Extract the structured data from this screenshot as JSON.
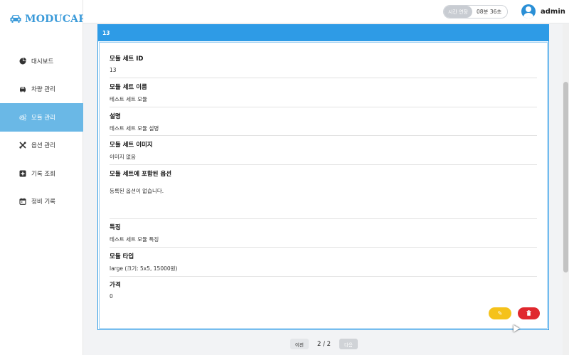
{
  "app": {
    "brand": "MODUCAR"
  },
  "sidebar": {
    "items": [
      {
        "label": "대시보드",
        "icon": "pie-chart-icon",
        "active": false
      },
      {
        "label": "차량 관리",
        "icon": "car-icon",
        "active": false
      },
      {
        "label": "모듈 관리",
        "icon": "gears-icon",
        "active": true
      },
      {
        "label": "옵션 관리",
        "icon": "tools-icon",
        "active": false
      },
      {
        "label": "기록 조회",
        "icon": "plus-square-icon",
        "active": false
      },
      {
        "label": "정비 기록",
        "icon": "calendar-icon",
        "active": false
      }
    ]
  },
  "header": {
    "extend_label": "시간 연장",
    "time_left": "08분 36초",
    "username": "admin"
  },
  "detail": {
    "header_id": "13",
    "fields": [
      {
        "label": "모듈 세트 ID",
        "value": "13"
      },
      {
        "label": "모듈 세트 이름",
        "value": "테스트 세트 모듈"
      },
      {
        "label": "설명",
        "value": "테스트 세트 모듈 설명"
      },
      {
        "label": "모듈 세트 이미지",
        "value": "이미지 없음"
      },
      {
        "label": "모듈 세트에 포함된 옵션",
        "value": "등록된 옵션이 없습니다."
      },
      {
        "label": "특징",
        "value": "테스트 세트 모듈 특징"
      },
      {
        "label": "모듈 타입",
        "value": "large (크기: 5x5, 15000원)"
      },
      {
        "label": "가격",
        "value": "0"
      }
    ],
    "edit_icon": "pencil-icon",
    "delete_icon": "trash-icon"
  },
  "pagination": {
    "prev_label": "이전",
    "info": "2 / 2",
    "next_label": "다음"
  },
  "colors": {
    "brand": "#3a9ad9",
    "active_nav": "#6ab8e6",
    "panel_header": "#2e9be6",
    "edit": "#f5c21b",
    "delete": "#e0282e"
  }
}
